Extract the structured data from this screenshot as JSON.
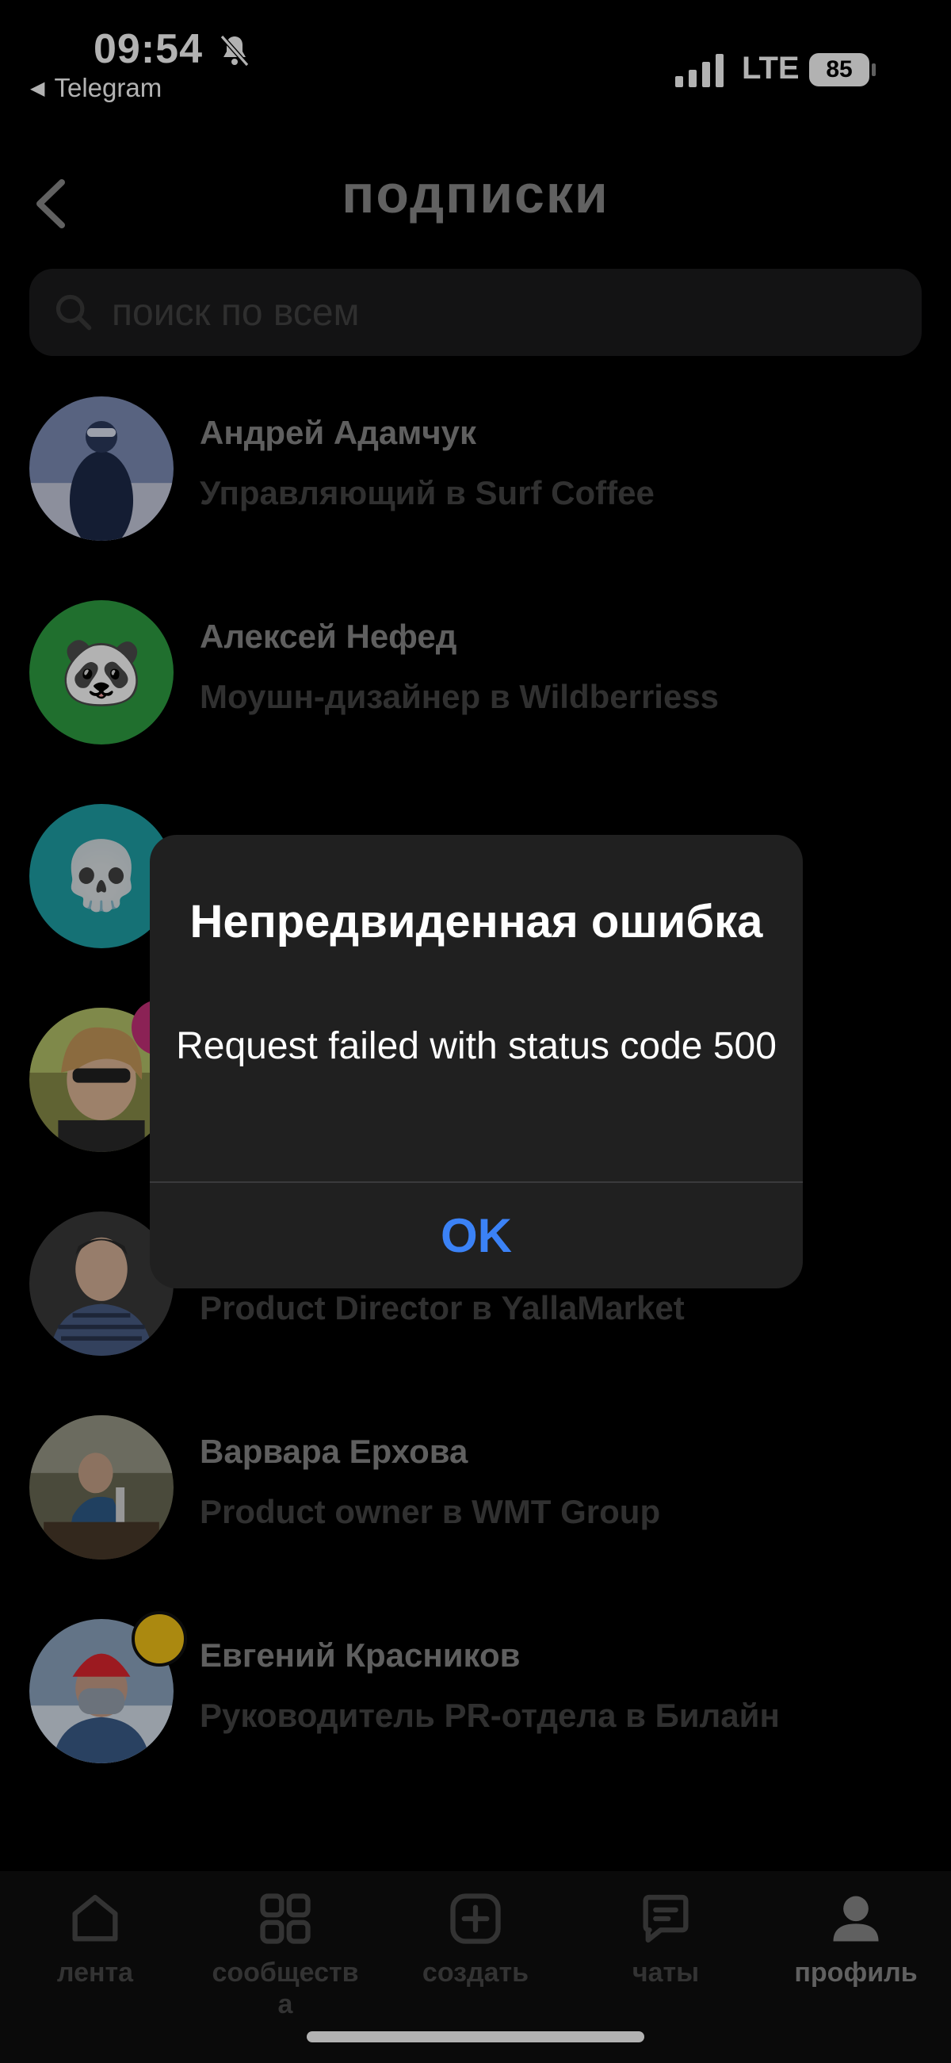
{
  "status_bar": {
    "time": "09:54",
    "back_app": "Telegram",
    "network": "LTE",
    "battery": "85"
  },
  "header": {
    "title": "подписки"
  },
  "search": {
    "placeholder": "поиск по всем"
  },
  "subscriptions": [
    {
      "name": "Андрей Адамчук",
      "role": "Управляющий в Surf Coffee",
      "avatar": "photo"
    },
    {
      "name": "Алексей Нефед",
      "role": "Моушн-дизайнер в Wildberriess",
      "avatar_emoji": "🐼",
      "avatar_color": "#2ea043"
    },
    {
      "name": "",
      "role": "",
      "avatar_emoji": "💀",
      "avatar_color": "#1fa3a8"
    },
    {
      "name": "",
      "role": "",
      "avatar": "photo"
    },
    {
      "name": "",
      "role": "Product Director в YallaMarket",
      "avatar": "photo"
    },
    {
      "name": "Варвара Ерхова",
      "role": "Product owner в WMT Group",
      "avatar": "photo"
    },
    {
      "name": "Евгений Красников",
      "role": "Руководитель PR-отдела в Билайн",
      "avatar": "photo",
      "badge_color": "#f5c518"
    }
  ],
  "tabbar": {
    "tabs": [
      {
        "label": "лента",
        "icon": "home-icon"
      },
      {
        "label": "сообществ\nа",
        "icon": "grid-icon"
      },
      {
        "label": "создать",
        "icon": "plus-square-icon"
      },
      {
        "label": "чаты",
        "icon": "chat-icon"
      },
      {
        "label": "профиль",
        "icon": "person-icon",
        "active": true
      }
    ]
  },
  "alert": {
    "title": "Непредвиденная ошибка",
    "message": "Request failed with status code 500",
    "ok_label": "OK"
  }
}
